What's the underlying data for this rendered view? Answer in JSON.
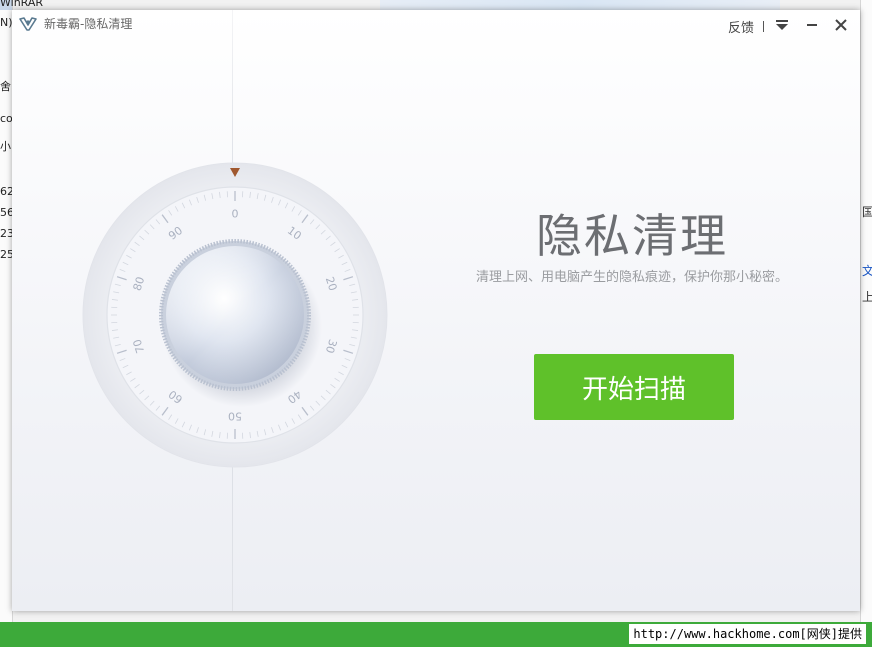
{
  "window": {
    "title": "新毒霸-隐私清理",
    "feedback_label": "反馈",
    "controls": {
      "menu_icon": "menu-dropdown-icon",
      "minimize_icon": "minimize-icon",
      "close_icon": "close-icon"
    }
  },
  "main": {
    "headline": "隐私清理",
    "subtitle": "清理上网、用电脑产生的隐私痕迹，保护你那小秘密。",
    "scan_button_label": "开始扫描"
  },
  "dial": {
    "ticks": [
      "0",
      "10",
      "20",
      "30",
      "40",
      "50",
      "60",
      "70",
      "80",
      "90"
    ],
    "pointer_color": "#a0582f",
    "knob_icon": "safe-dial-knob"
  },
  "background": {
    "left_fragments": [
      "WinRAR",
      "N)",
      "舍",
      "co",
      "小",
      "62",
      "56",
      "23",
      "25"
    ],
    "right_fragments": [
      "国",
      "文",
      "上行"
    ],
    "watermark": "http://www.hackhome.com[网侠]提供",
    "taskbar_color": "#3daa3a"
  },
  "colors": {
    "accent_green": "#5fc12a",
    "headline": "#6c6e72",
    "subtitle": "#9a9ca0"
  }
}
